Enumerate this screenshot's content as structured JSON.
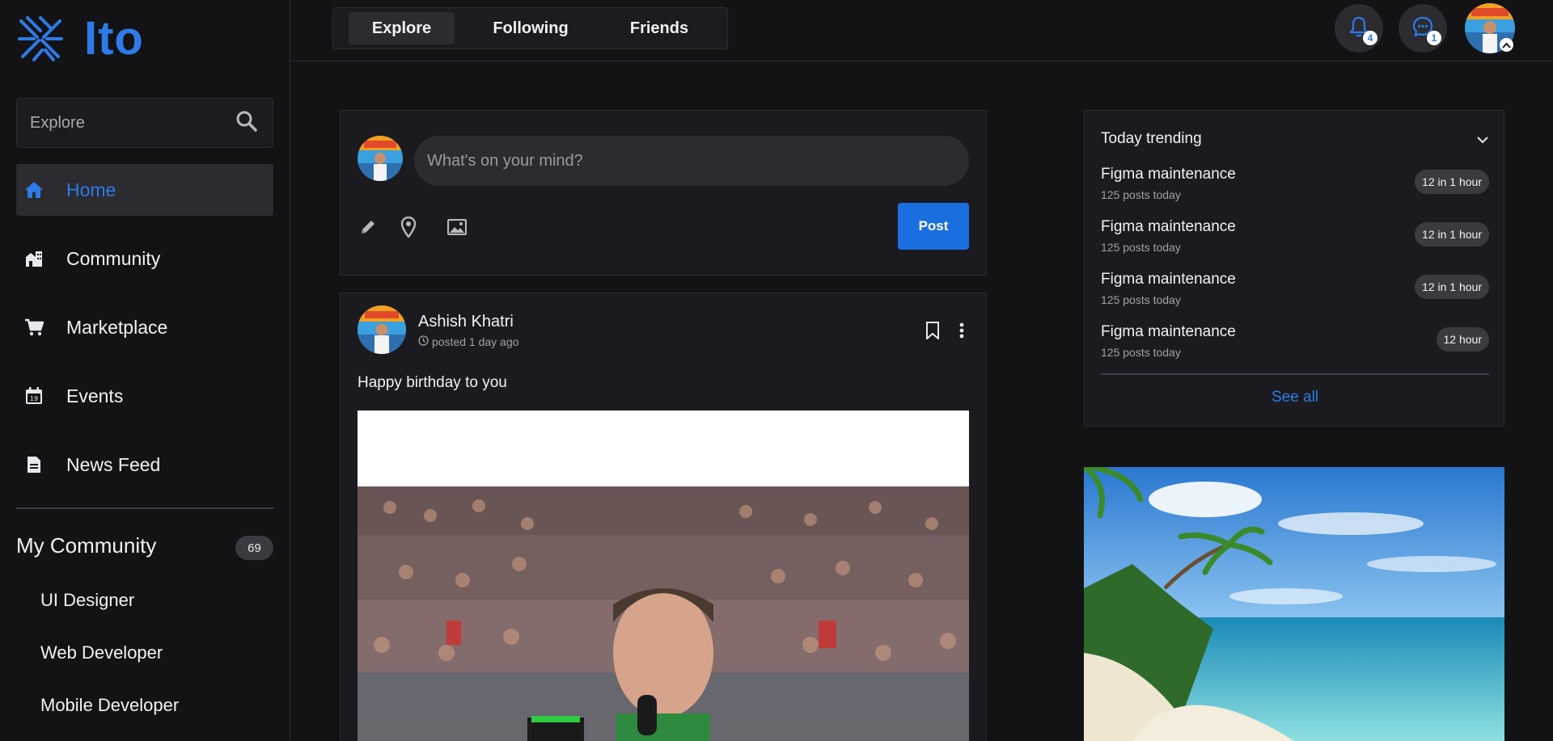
{
  "brand": {
    "name": "Ito",
    "accent_color": "#2d7be8"
  },
  "search": {
    "placeholder": "Explore",
    "icon": "search-icon"
  },
  "sidebar": {
    "items": [
      {
        "label": "Home",
        "icon": "home-icon",
        "active": true
      },
      {
        "label": "Community",
        "icon": "community-icon"
      },
      {
        "label": "Marketplace",
        "icon": "cart-icon"
      },
      {
        "label": "Events",
        "icon": "calendar-icon"
      },
      {
        "label": "News Feed",
        "icon": "news-feed-icon"
      }
    ],
    "my_community": {
      "title": "My Community",
      "count": "69",
      "items": [
        "UI Designer",
        "Web Developer",
        "Mobile Developer"
      ]
    }
  },
  "topbar": {
    "tabs": [
      "Explore",
      "Following",
      "Friends"
    ],
    "active_tab": "Explore",
    "notifications_count": "4",
    "messages_count": "1"
  },
  "composer": {
    "placeholder": "What's on your mind?",
    "post_label": "Post",
    "tools": [
      "pencil-icon",
      "location-pin-icon",
      "image-icon"
    ]
  },
  "post": {
    "author": "Ashish Khatri",
    "posted": "posted 1 day ago",
    "text": "Happy birthday to you"
  },
  "trending": {
    "title": "Today trending",
    "items": [
      {
        "name": "Figma maintenance",
        "sub": "125 posts today",
        "pill": "12 in 1 hour"
      },
      {
        "name": "Figma maintenance",
        "sub": "125 posts today",
        "pill": "12 in 1 hour"
      },
      {
        "name": "Figma maintenance",
        "sub": "125 posts today",
        "pill": "12 in 1 hour"
      },
      {
        "name": "Figma maintenance",
        "sub": "125 posts today",
        "pill": "12 hour"
      }
    ],
    "see_all": "See all"
  }
}
